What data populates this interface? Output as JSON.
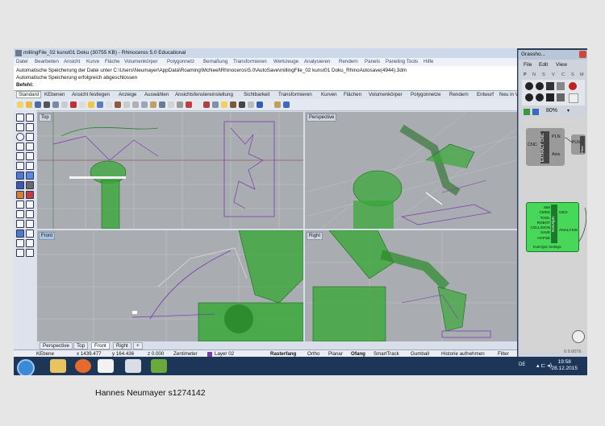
{
  "rhino": {
    "title": "millingFile_02 kunst01 Doku (30755 KB) - Rhinoceros 5.0 Educational",
    "menu": [
      "Datei",
      "Bearbeiten",
      "Ansicht",
      "Kurve",
      "Fläche",
      "Volumenkörper",
      "Polygonnetz",
      "Bemaßung",
      "Transformieren",
      "Werkzeuge",
      "Analysieren",
      "Rendern",
      "Panels",
      "Paneling Tools",
      "Hilfe"
    ],
    "history_line1": "Automatische Speicherung der Datei unter C:\\Users\\Neumayer\\AppData\\Roaming\\McNeel\\Rhinoceros\\5.0\\AutoSave\\millingFile_02 kunst01 Doku_RhinoAutosave(4944).3dm",
    "history_line2": "Automatische Speicherung erfolgreich abgeschlossen",
    "command_prompt": "Befehl:",
    "toolbar_tabs": [
      "Standard",
      "KEbenen",
      "Ansicht festlegen",
      "Anzeige",
      "Auswählen",
      "Ansichtsfenstereinstellung",
      "Sichtbarkeit",
      "Transformieren",
      "Kurven",
      "Flächen",
      "Volumenkörper",
      "Polygonnetze",
      "Rendern",
      "Entwurf",
      "Neu in V5"
    ],
    "viewports": {
      "top": "Top",
      "perspective": "Perspective",
      "front": "Front",
      "right": "Right"
    },
    "viewport_tabs": [
      "Perspective",
      "Top",
      "Front",
      "Right"
    ],
    "viewport_tab_add": "+",
    "status": {
      "layer": "KEbene",
      "x": "x 1439.477",
      "y": "y 164.436",
      "z": "z 0.000",
      "units": "Zentimeter",
      "current_layer": "Layer 02",
      "snap": "Rasterfang",
      "ortho": "Ortho",
      "planar": "Planar",
      "osnap": "Ofang",
      "smarttrack": "SmartTrack",
      "gumball": "Gumball",
      "history": "Historie aufnehmen",
      "filter": "Filter"
    }
  },
  "grasshopper": {
    "title": "Grassho...",
    "menu": [
      "File",
      "Edit",
      "View"
    ],
    "tabs": [
      "P",
      "N",
      "S",
      "V",
      "C",
      "S",
      "M"
    ],
    "zoom": "80%",
    "component1": {
      "label": "EXTRACT CNC",
      "input": "CNC",
      "outputs": [
        "PLN",
        "Axis"
      ]
    },
    "component2": {
      "label": "Filter",
      "input": "PLN"
    },
    "component3": {
      "label": "KUKA|prc",
      "inputs": [
        "SIM",
        "CMDS",
        "TOOL",
        "ROBOT",
        "COLLISION",
        "SAVE",
        "HAPSE"
      ],
      "outputs": [
        "GEO",
        "ANALYSIS"
      ],
      "footer": "KUKA|prc Settings"
    },
    "version": "0.9.0076"
  },
  "taskbar": {
    "lang": "DE",
    "time": "19:58",
    "date": "28.12.2015"
  },
  "caption": "Hannes Neumayer s1274142"
}
